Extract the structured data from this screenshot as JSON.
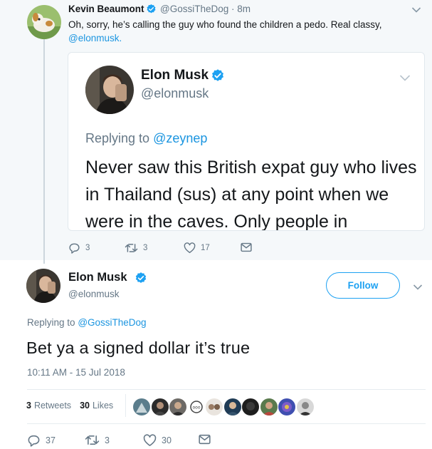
{
  "reply_tweet": {
    "author_name": "Kevin Beaumont",
    "author_handle": "@GossiTheDog · 8m",
    "text": "Oh, sorry, he’s calling the guy who found the children a pedo. Real classy,",
    "mention": "@elonmusk.",
    "quoted": {
      "author_name": "Elon Musk",
      "author_handle": "@elonmusk",
      "replying_label": "Replying to",
      "replying_to": "@zeynep",
      "text": "Never saw this British expat guy who lives in Thailand (sus) at any point when we were in the caves. Only people in"
    },
    "actions": {
      "replies": "3",
      "retweets": "3",
      "likes": "17"
    }
  },
  "main_tweet": {
    "author_name": "Elon Musk",
    "author_handle": "@elonmusk",
    "follow_label": "Follow",
    "replying_label": "Replying to",
    "replying_to": "@GossiTheDog",
    "text": "Bet ya a signed dollar it’s true",
    "timestamp": "10:11 AM - 15 Jul 2018",
    "retweets_count": "3",
    "retweets_label": "Retweets",
    "likes_count": "30",
    "likes_label": "Likes",
    "actions": {
      "replies": "37",
      "retweets": "3",
      "likes": "30"
    }
  },
  "colors": {
    "accent": "#1da1f2",
    "mention": "#1b95e0",
    "secondary_text": "#657786",
    "reply_background": "#f5f8fa",
    "verified": "#1da1f2"
  },
  "icons": [
    "verified-badge-icon",
    "chevron-down-icon",
    "reply-icon",
    "retweet-icon",
    "like-icon",
    "dm-icon"
  ]
}
